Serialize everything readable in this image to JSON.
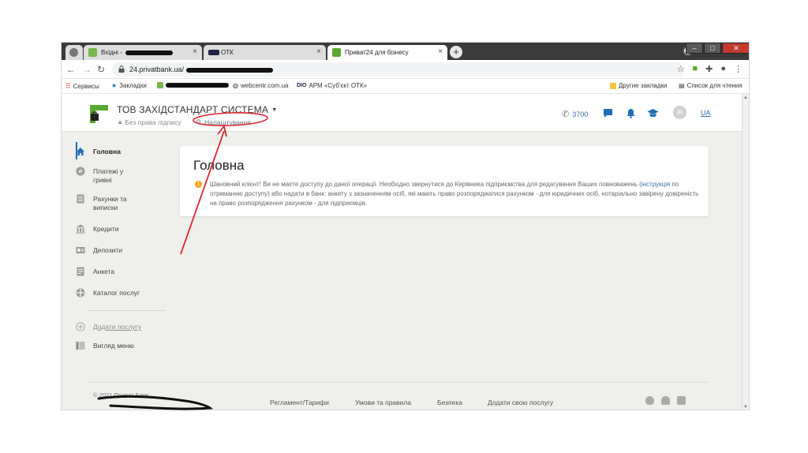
{
  "browser": {
    "tabs": [
      {
        "title": "Вхідні -",
        "close": "×"
      },
      {
        "title": "ОТК",
        "close": "×"
      },
      {
        "title": "Приват24 для бізнесу",
        "close": "×"
      }
    ],
    "new_tab": "+",
    "window_buttons": [
      "–",
      "□",
      "✕"
    ],
    "url": "24.privatbank.ua/",
    "bookmarks": {
      "services": "Сервисы",
      "bookmarks": "Закладки",
      "webcentr": "webcentr.com.ua",
      "arm": "АРМ «Суб'єкт ОТК»",
      "other": "Другие закладки",
      "reading": "Список для чтения"
    }
  },
  "header": {
    "company": "ТОВ ЗАХІДСТАНДАРТ СИСТЕМА",
    "no_sign": "Без права підпису",
    "settings": "Налаштування",
    "phone": "3700",
    "avatar": "Ж",
    "lang": "UA"
  },
  "sidebar": {
    "items": [
      {
        "label": "Головна"
      },
      {
        "label": "Платежі у гривні"
      },
      {
        "label": "Рахунки та виписки"
      },
      {
        "label": "Кредити"
      },
      {
        "label": "Депозити"
      },
      {
        "label": "Анкета"
      },
      {
        "label": "Каталог послуг"
      }
    ],
    "add_service": "Додати послугу",
    "menu_view": "Вигляд меню"
  },
  "main": {
    "title": "Головна",
    "warning_a": "Шановний клієнт! Ви не маєте доступу до даної операції. Необхідно звернутися до Керівника підприємства для редагування Ваших повноважень (",
    "warning_link": "інструкція",
    "warning_b": " по отриманню доступу) або надати в банк: анкету з зазначенням осіб, які мають право розпоряджатися рахунком - для юридичних осіб, нотаріально завірену довіреність на право розпорядження рахунком - для підприємців."
  },
  "footer": {
    "copyright": "© 2021 Приват Банк",
    "links": [
      "Регламент/Тарифи",
      "Умови та правила",
      "Безпека",
      "Додати свою послугу"
    ]
  },
  "colors": {
    "brand_green": "#5ba731",
    "link_blue": "#3a6ea5",
    "warning": "#f2a71b",
    "annotation_red": "#d9252a"
  }
}
